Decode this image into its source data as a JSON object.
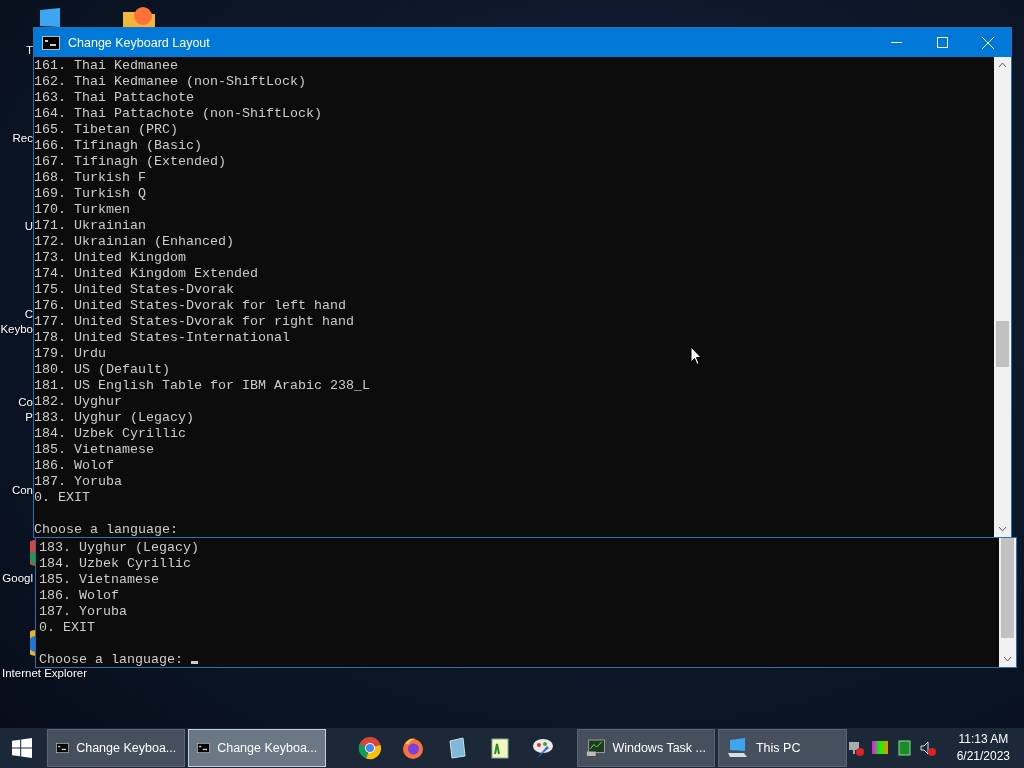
{
  "desktop": {
    "icons": [
      {
        "lines": [
          "T"
        ]
      },
      {
        "lines": [
          "Rec"
        ]
      },
      {
        "lines": [
          "U"
        ]
      },
      {
        "lines": [
          "C",
          "Keybo"
        ]
      },
      {
        "lines": [
          "Co",
          "P"
        ]
      },
      {
        "lines": [
          "Con"
        ]
      },
      {
        "lines": [
          "Googl"
        ]
      },
      {
        "lines": [
          "Internet Explorer"
        ]
      }
    ]
  },
  "back_window": {
    "lines": [
      "183. Uyghur (Legacy)",
      "184. Uzbek Cyrillic",
      "185. Vietnamese",
      "186. Wolof",
      "187. Yoruba",
      "0. EXIT"
    ],
    "prompt": "Choose a language: "
  },
  "window": {
    "title": "Change Keyboard Layout",
    "lines": [
      "161. Thai Kedmanee",
      "162. Thai Kedmanee (non-ShiftLock)",
      "163. Thai Pattachote",
      "164. Thai Pattachote (non-ShiftLock)",
      "165. Tibetan (PRC)",
      "166. Tifinagh (Basic)",
      "167. Tifinagh (Extended)",
      "168. Turkish F",
      "169. Turkish Q",
      "170. Turkmen",
      "171. Ukrainian",
      "172. Ukrainian (Enhanced)",
      "173. United Kingdom",
      "174. United Kingdom Extended",
      "175. United States-Dvorak",
      "176. United States-Dvorak for left hand",
      "177. United States-Dvorak for right hand",
      "178. United States-International",
      "179. Urdu",
      "180. US (Default)",
      "181. US English Table for IBM Arabic 238_L",
      "182. Uyghur",
      "183. Uyghur (Legacy)",
      "184. Uzbek Cyrillic",
      "185. Vietnamese",
      "186. Wolof",
      "187. Yoruba",
      "0. EXIT"
    ],
    "prompt": "Choose a language:"
  },
  "taskbar": {
    "items": [
      {
        "kind": "window",
        "label": "Change Keyboa...",
        "selected": false
      },
      {
        "kind": "window",
        "label": "Change Keyboa...",
        "selected": true
      },
      {
        "kind": "pinned"
      },
      {
        "kind": "pinned"
      },
      {
        "kind": "pinned"
      },
      {
        "kind": "pinned"
      },
      {
        "kind": "pinned"
      },
      {
        "kind": "window",
        "label": "Windows Task ...",
        "selected": false
      },
      {
        "kind": "window",
        "label": "This PC",
        "selected": false
      }
    ],
    "time": "11:13 AM",
    "date": "6/21/2023"
  }
}
